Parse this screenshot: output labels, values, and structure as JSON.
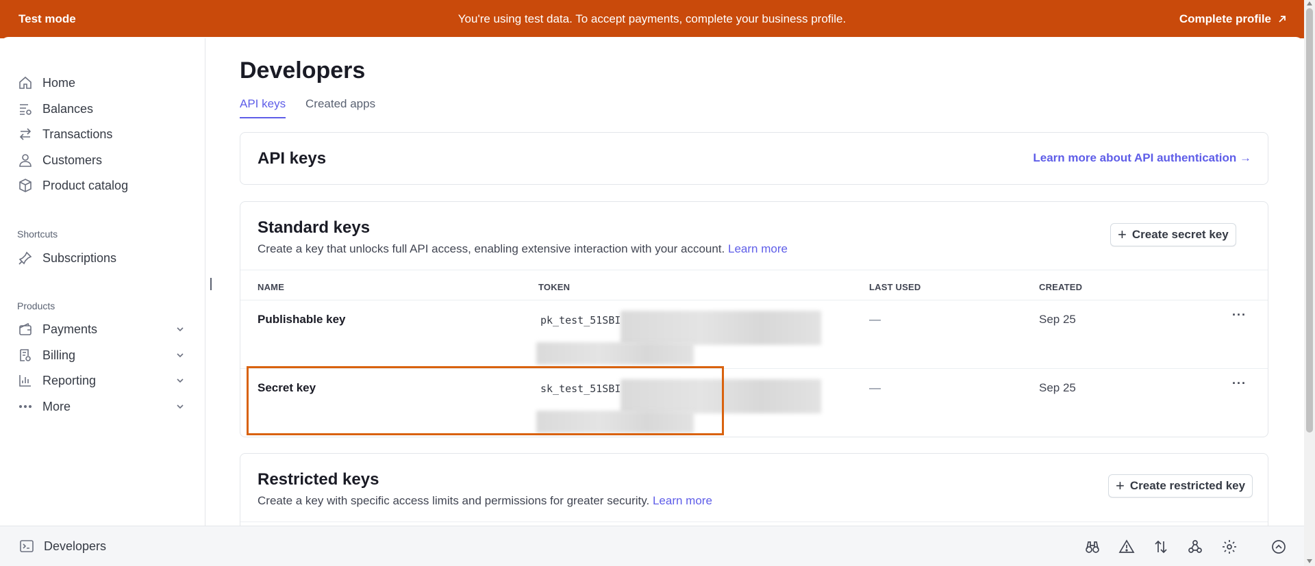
{
  "banner": {
    "mode": "Test mode",
    "message": "You're using test data. To accept payments, complete your business profile.",
    "cta": "Complete profile",
    "color": "#c94a0b"
  },
  "sidebar": {
    "items": [
      {
        "label": "Home",
        "icon": "home-icon"
      },
      {
        "label": "Balances",
        "icon": "balances-icon"
      },
      {
        "label": "Transactions",
        "icon": "transactions-icon"
      },
      {
        "label": "Customers",
        "icon": "person-icon"
      },
      {
        "label": "Product catalog",
        "icon": "box-icon"
      }
    ],
    "shortcuts_label": "Shortcuts",
    "shortcuts": [
      {
        "label": "Subscriptions",
        "icon": "pin-icon"
      }
    ],
    "products_label": "Products",
    "products": [
      {
        "label": "Payments",
        "icon": "wallet-icon"
      },
      {
        "label": "Billing",
        "icon": "billing-icon"
      },
      {
        "label": "Reporting",
        "icon": "chart-icon"
      },
      {
        "label": "More",
        "icon": "dots-icon"
      }
    ]
  },
  "main": {
    "title": "Developers",
    "tabs": [
      {
        "label": "API keys",
        "active": true
      },
      {
        "label": "Created apps",
        "active": false
      }
    ],
    "api_card": {
      "title": "API keys",
      "link": "Learn more about API authentication →"
    },
    "standard": {
      "title": "Standard keys",
      "description": "Create a key that unlocks full API access, enabling extensive interaction with your account.",
      "learn_more": "Learn more",
      "button": "Create secret key",
      "columns": [
        "NAME",
        "TOKEN",
        "LAST USED",
        "CREATED"
      ],
      "rows": [
        {
          "name": "Publishable key",
          "token": "pk_test_51SBI",
          "last_used": "—",
          "created": "Sep 25"
        },
        {
          "name": "Secret key",
          "token": "sk_test_51SBI",
          "last_used": "—",
          "created": "Sep 25"
        }
      ]
    },
    "restricted": {
      "title": "Restricted keys",
      "description": "Create a key with specific access limits and permissions for greater security.",
      "learn_more": "Learn more",
      "button": "Create restricted key"
    }
  },
  "bottombar": {
    "label": "Developers",
    "icons": [
      "binoculars-icon",
      "warning-icon",
      "arrows-updown-icon",
      "webhook-icon",
      "gear-icon",
      "chevron-up-circle-icon"
    ]
  },
  "colors": {
    "accent": "#5e5de8",
    "highlight": "#d9620e"
  }
}
